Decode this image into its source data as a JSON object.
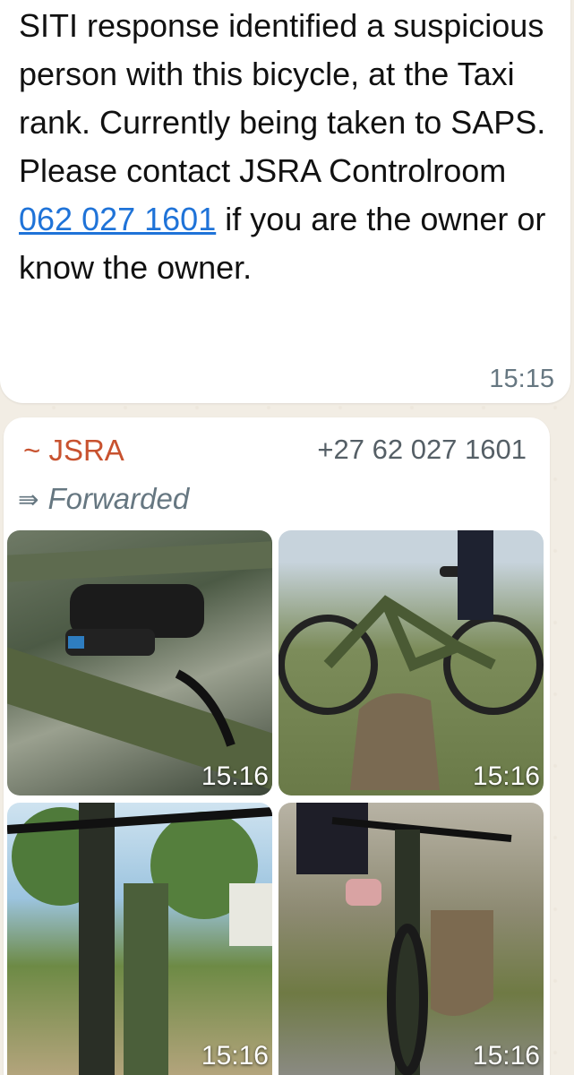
{
  "message1": {
    "text_before": "SITI response identified a suspicious person with this bicycle, at the Taxi rank. Currently being taken to SAPS. Please contact JSRA Controlroom ",
    "phone_link": "062 027 1601",
    "text_after": " if you are the owner or know the owner.",
    "time": "15:15"
  },
  "message2": {
    "sender": "~ JSRA",
    "sender_color": "#c8522f",
    "phone": "+27 62 027 1601",
    "forwarded_label": "Forwarded",
    "forwarded_icon": "forward-icon",
    "photos": [
      {
        "time": "15:16",
        "subject": "bicycle-shock-closeup"
      },
      {
        "time": "15:16",
        "subject": "bicycle-side-view"
      },
      {
        "time": "15:16",
        "subject": "bicycle-handlebar-view"
      },
      {
        "time": "15:16",
        "subject": "bicycle-front-view"
      }
    ]
  },
  "colors": {
    "link": "#1f73d8",
    "timestamp": "#667781",
    "background": "#f2ede4"
  }
}
